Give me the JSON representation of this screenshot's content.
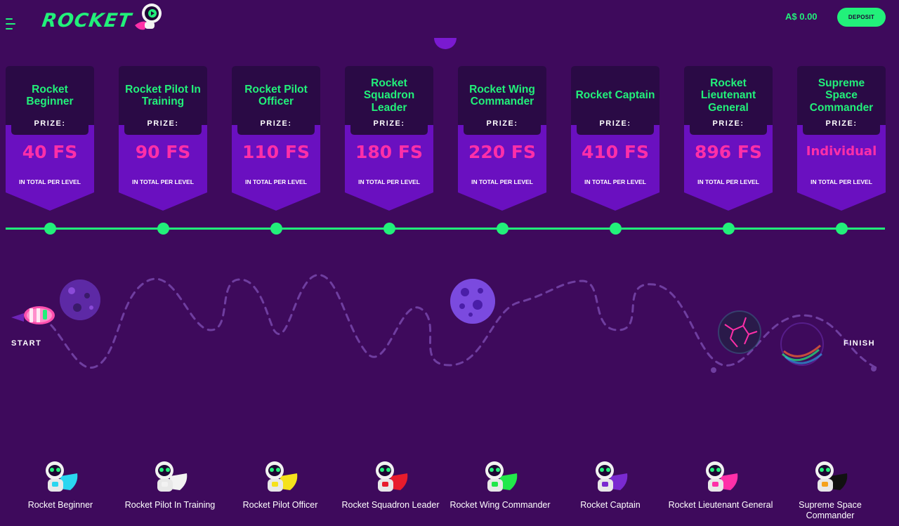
{
  "header": {
    "logo_text": "ROCKET",
    "balance": "A$ 0.00",
    "deposit_label": "DEPOSIT"
  },
  "colors": {
    "background": "#3e0a5c",
    "accent_green": "#22f07a",
    "prize_pink": "#ff2fa8",
    "card_dark": "#2a0a45",
    "card_purple": "#6a10c0"
  },
  "levels": [
    {
      "title": "Rocket Beginner",
      "prize_label": "PRIZE:",
      "prize": "40 FS",
      "total": "IN TOTAL PER LEVEL"
    },
    {
      "title": "Rocket Pilot In Training",
      "prize_label": "PRIZE:",
      "prize": "90 FS",
      "total": "IN TOTAL PER LEVEL"
    },
    {
      "title": "Rocket Pilot Officer",
      "prize_label": "PRIZE:",
      "prize": "110 FS",
      "total": "IN TOTAL PER LEVEL"
    },
    {
      "title": "Rocket Squadron Leader",
      "prize_label": "PRIZE:",
      "prize": "180 FS",
      "total": "IN TOTAL PER LEVEL"
    },
    {
      "title": "Rocket Wing Commander",
      "prize_label": "PRIZE:",
      "prize": "220 FS",
      "total": "IN TOTAL PER LEVEL"
    },
    {
      "title": "Rocket Captain",
      "prize_label": "PRIZE:",
      "prize": "410 FS",
      "total": "IN TOTAL PER LEVEL"
    },
    {
      "title": "Rocket Lieutenant General",
      "prize_label": "PRIZE:",
      "prize": "896 FS",
      "total": "IN TOTAL PER LEVEL"
    },
    {
      "title": "Supreme Space Commander",
      "prize_label": "PRIZE:",
      "prize": "Individual",
      "total": "IN TOTAL PER LEVEL"
    }
  ],
  "journey": {
    "start_label": "START",
    "finish_label": "FINISH"
  },
  "ranks": [
    {
      "label": "Rocket Beginner",
      "cape_color": "#2ad6f0",
      "badge_color": "#2ad6f0"
    },
    {
      "label": "Rocket Pilot In Training",
      "cape_color": "#f2f2f2",
      "badge_color": "#f2f2f2"
    },
    {
      "label": "Rocket Pilot Officer",
      "cape_color": "#f5e21c",
      "badge_color": "#f5e21c"
    },
    {
      "label": "Rocket Squadron Leader",
      "cape_color": "#e81c2c",
      "badge_color": "#e81c2c"
    },
    {
      "label": "Rocket Wing Commander",
      "cape_color": "#22e84a",
      "badge_color": "#22e84a"
    },
    {
      "label": "Rocket Captain",
      "cape_color": "#7a2ad0",
      "badge_color": "#7a2ad0"
    },
    {
      "label": "Rocket Lieutenant General",
      "cape_color": "#ff2fa8",
      "badge_color": "#ff2fa8"
    },
    {
      "label": "Supreme Space Commander",
      "cape_color": "#111111",
      "badge_color": "#f5a21c"
    }
  ]
}
